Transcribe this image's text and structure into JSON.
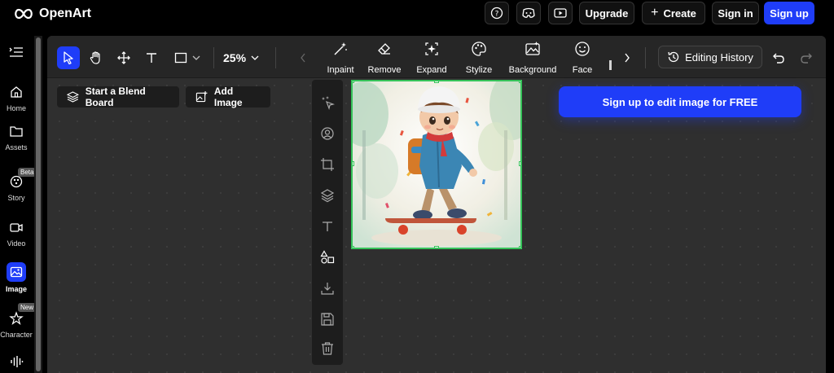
{
  "app": {
    "name": "OpenArt"
  },
  "topbar": {
    "upgrade_label": "Upgrade",
    "create_label": "Create",
    "signin_label": "Sign in",
    "signup_label": "Sign up"
  },
  "sidebar": {
    "items": [
      {
        "label": "Home",
        "icon": "home-icon"
      },
      {
        "label": "Assets",
        "icon": "folder-icon"
      },
      {
        "label": "Story",
        "icon": "story-icon",
        "badge": "Beta"
      },
      {
        "label": "Video",
        "icon": "video-icon"
      },
      {
        "label": "Image",
        "icon": "image-icon",
        "active": true
      },
      {
        "label": "Character",
        "icon": "character-icon",
        "badge": "New"
      }
    ]
  },
  "toolbar": {
    "zoom": "25%",
    "features": [
      "Inpaint",
      "Remove",
      "Expand",
      "Stylize",
      "Background",
      "Face"
    ],
    "editing_history_label": "Editing History"
  },
  "canvas": {
    "blend_board_label": "Start a Blend Board",
    "add_image_label": "Add Image",
    "signup_banner": "Sign up to edit image for FREE"
  },
  "colors": {
    "accent": "#1f3df8",
    "selection": "#36c35a",
    "workspace": "#2f2f2f"
  }
}
